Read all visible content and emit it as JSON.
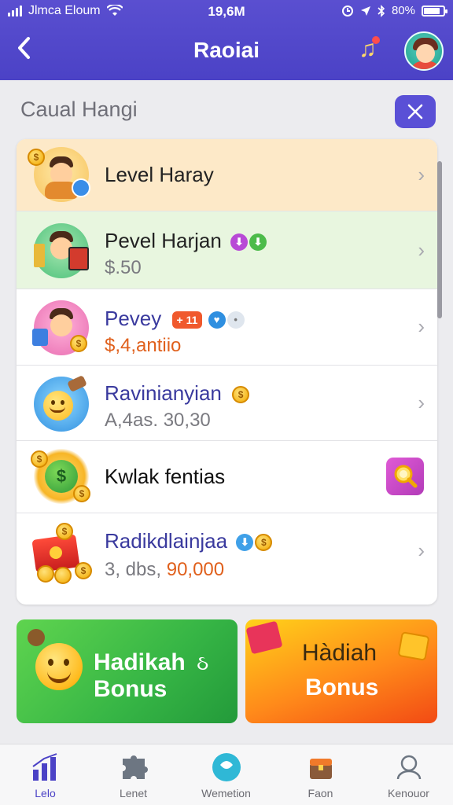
{
  "status_bar": {
    "carrier": "Jlmca Eloum",
    "time": "19,6M",
    "battery": "80%"
  },
  "header": {
    "title": "Raoiai",
    "back_icon": "chevron-left-icon",
    "music_icon": "music-note-icon"
  },
  "section": {
    "title": "Caual Hanɡi"
  },
  "list": [
    {
      "name": "Level Haray",
      "sub": ""
    },
    {
      "name": "Pevel Harjan",
      "sub": "$.50"
    },
    {
      "name": "Pevey",
      "sub": "$,4,antiio",
      "pill": "+ 11"
    },
    {
      "name": "Ravinianyian",
      "sub": "A,4as. 30,30"
    },
    {
      "name": "Kwlak fentias",
      "sub": ""
    },
    {
      "name": "Radikdlainjaa",
      "sub_prefix": "3, dbs,",
      "sub_value": "90,000"
    }
  ],
  "tiles": {
    "green": {
      "line1": "Hadikah",
      "line1_suffix": "ઠ",
      "line2": "Bonus"
    },
    "orange": {
      "line1": "Hàdiah",
      "line2": "Bonus"
    }
  },
  "tabs": [
    {
      "label": "Lelo"
    },
    {
      "label": "Lenet"
    },
    {
      "label": "Wemetion"
    },
    {
      "label": "Faon"
    },
    {
      "label": "Kenouor"
    }
  ],
  "colors": {
    "header": "#4b42c6",
    "accent": "#5a50d6",
    "row1_bg": "#fde9c8",
    "row2_bg": "#e8f6df",
    "price_orange": "#e0601c"
  }
}
